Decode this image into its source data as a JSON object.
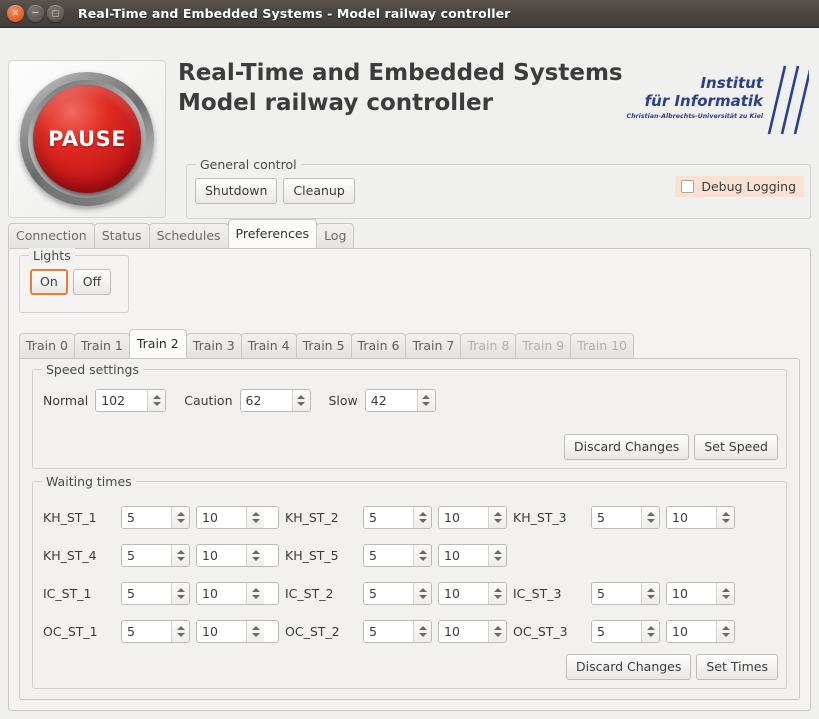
{
  "window": {
    "title": "Real-Time and Embedded Systems - Model railway controller",
    "controls": [
      {
        "name": "close",
        "glyph": "×"
      },
      {
        "name": "minimize",
        "glyph": "−"
      },
      {
        "name": "maximize",
        "glyph": "□"
      }
    ]
  },
  "header": {
    "pause_button_label": "PAUSE",
    "title_line1": "Real-Time and Embedded Systems",
    "title_line2": "Model railway controller",
    "logo": {
      "line1": "Institut",
      "line2": "für Informatik",
      "line3": "Christian-Albrechts-Universität zu Kiel",
      "color": "#2a3f8f"
    }
  },
  "general_control": {
    "title": "General control",
    "shutdown_label": "Shutdown",
    "cleanup_label": "Cleanup",
    "debug_logging_label": "Debug Logging",
    "debug_logging_checked": false,
    "debug_highlight_color": "#fbe1d2"
  },
  "main_tabs": {
    "items": [
      {
        "label": "Connection",
        "selected": false
      },
      {
        "label": "Status",
        "selected": false
      },
      {
        "label": "Schedules",
        "selected": false
      },
      {
        "label": "Preferences",
        "selected": true
      },
      {
        "label": "Log",
        "selected": false
      }
    ]
  },
  "lights": {
    "title": "Lights",
    "on_label": "On",
    "off_label": "Off",
    "focus_color": "#e8803a",
    "focused": "on"
  },
  "train_tabs": {
    "items": [
      {
        "label": "Train 0",
        "selected": false,
        "disabled": false
      },
      {
        "label": "Train 1",
        "selected": false,
        "disabled": false
      },
      {
        "label": "Train 2",
        "selected": true,
        "disabled": false
      },
      {
        "label": "Train 3",
        "selected": false,
        "disabled": false
      },
      {
        "label": "Train 4",
        "selected": false,
        "disabled": false
      },
      {
        "label": "Train 5",
        "selected": false,
        "disabled": false
      },
      {
        "label": "Train 6",
        "selected": false,
        "disabled": false
      },
      {
        "label": "Train 7",
        "selected": false,
        "disabled": false
      },
      {
        "label": "Train 8",
        "selected": false,
        "disabled": true
      },
      {
        "label": "Train 9",
        "selected": false,
        "disabled": true
      },
      {
        "label": "Train 10",
        "selected": false,
        "disabled": true
      }
    ]
  },
  "speed_settings": {
    "title": "Speed settings",
    "normal_label": "Normal",
    "normal_value": "102",
    "caution_label": "Caution",
    "caution_value": "62",
    "slow_label": "Slow",
    "slow_value": "42",
    "discard_label": "Discard Changes",
    "set_label": "Set Speed"
  },
  "waiting_times": {
    "title": "Waiting times",
    "discard_label": "Discard Changes",
    "set_label": "Set Times",
    "rows": [
      [
        {
          "label": "KH_ST_1",
          "v1": "5",
          "v2": "10"
        },
        {
          "label": "KH_ST_2",
          "v1": "5",
          "v2": "10"
        },
        {
          "label": "KH_ST_3",
          "v1": "5",
          "v2": "10"
        }
      ],
      [
        {
          "label": "KH_ST_4",
          "v1": "5",
          "v2": "10"
        },
        {
          "label": "KH_ST_5",
          "v1": "5",
          "v2": "10"
        }
      ],
      [
        {
          "label": "IC_ST_1",
          "v1": "5",
          "v2": "10"
        },
        {
          "label": "IC_ST_2",
          "v1": "5",
          "v2": "10"
        },
        {
          "label": "IC_ST_3",
          "v1": "5",
          "v2": "10"
        }
      ],
      [
        {
          "label": "OC_ST_1",
          "v1": "5",
          "v2": "10"
        },
        {
          "label": "OC_ST_2",
          "v1": "5",
          "v2": "10"
        },
        {
          "label": "OC_ST_3",
          "v1": "5",
          "v2": "10"
        }
      ]
    ]
  }
}
